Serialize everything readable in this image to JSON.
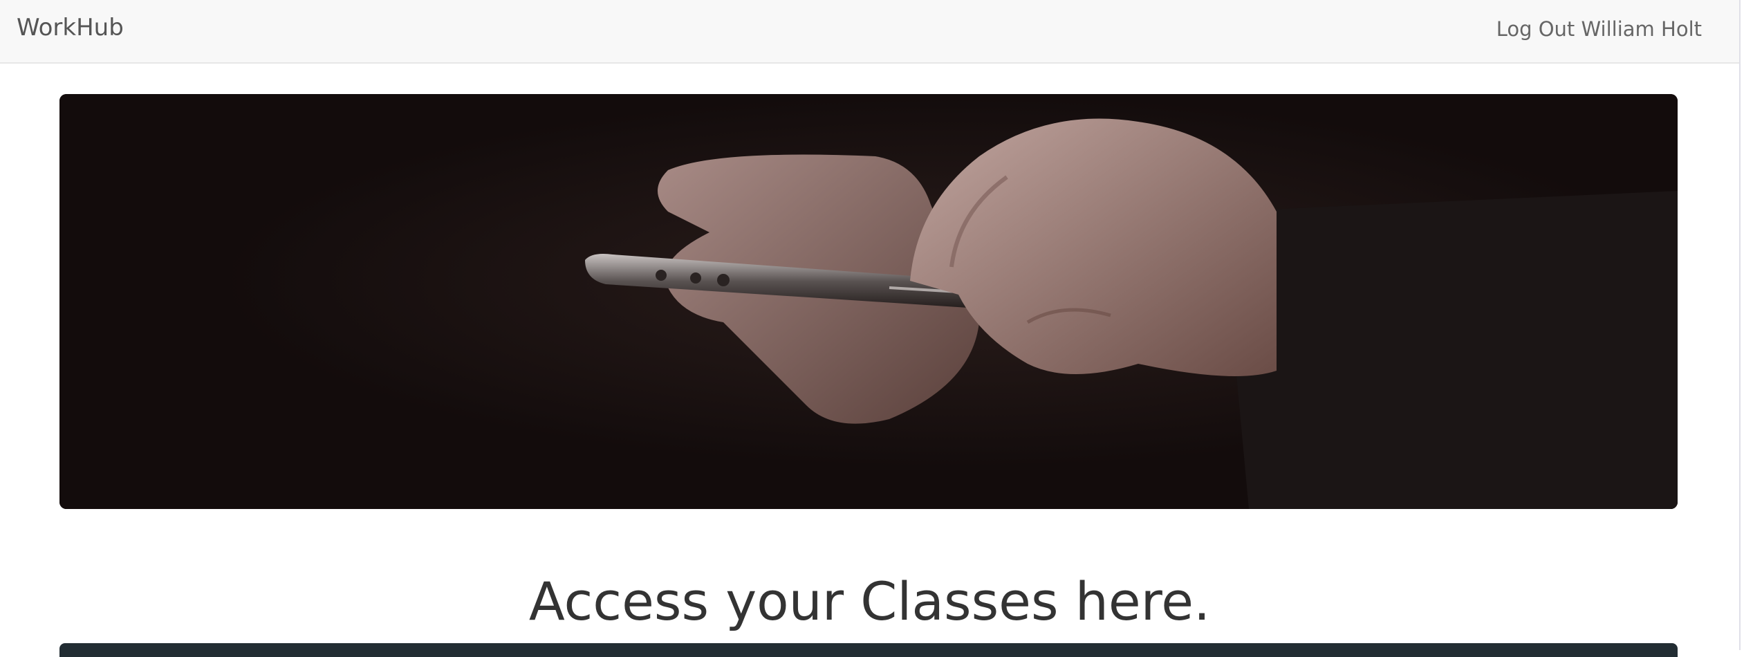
{
  "navbar": {
    "brand": "WorkHub",
    "logout_label": "Log Out",
    "user_name": "William Holt"
  },
  "hero": {
    "image_subject": "hands-holding-smartphone-photo"
  },
  "main": {
    "headline": "Access your Classes here."
  },
  "colors": {
    "navbar_bg": "#f8f8f8",
    "hero_bg": "#160f0f",
    "headline": "#333333",
    "panel_top": "#222d33"
  }
}
